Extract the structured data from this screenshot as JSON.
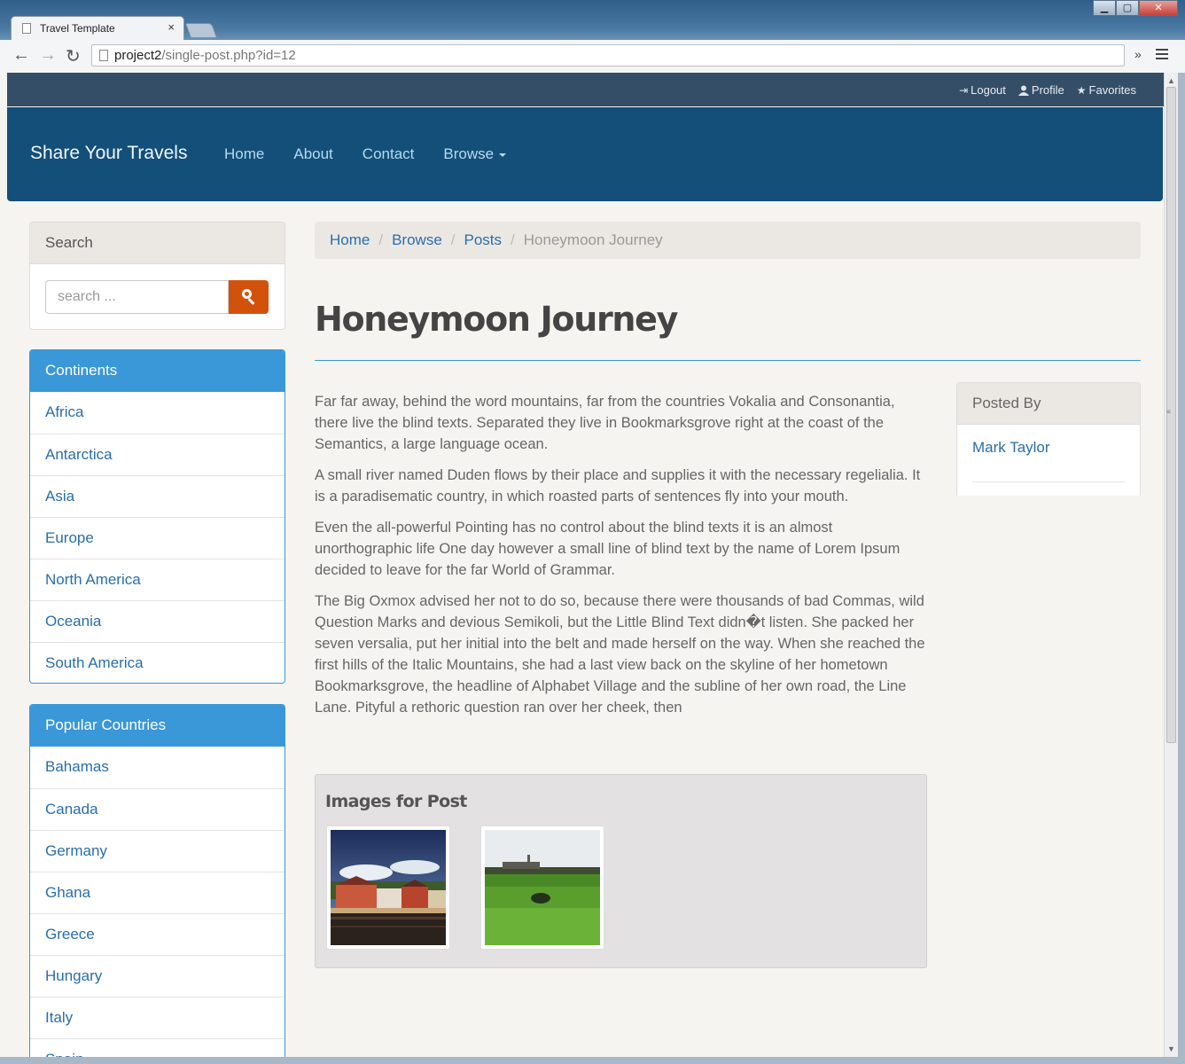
{
  "browser": {
    "tab_title": "Travel Template",
    "tab_close": "×",
    "url_host": "project2",
    "url_path": "/single-post.php?id=12",
    "extensions_glyph": "»"
  },
  "userbar": {
    "logout": "Logout",
    "profile": "Profile",
    "favorites": "Favorites"
  },
  "navbar": {
    "brand": "Share Your Travels",
    "links": [
      "Home",
      "About",
      "Contact",
      "Browse"
    ]
  },
  "search": {
    "heading": "Search",
    "placeholder": "search ..."
  },
  "continents": {
    "heading": "Continents",
    "items": [
      "Africa",
      "Antarctica",
      "Asia",
      "Europe",
      "North America",
      "Oceania",
      "South America"
    ]
  },
  "countries": {
    "heading": "Popular Countries",
    "items": [
      "Bahamas",
      "Canada",
      "Germany",
      "Ghana",
      "Greece",
      "Hungary",
      "Italy",
      "Spain"
    ]
  },
  "breadcrumb": {
    "items": [
      "Home",
      "Browse",
      "Posts"
    ],
    "active": "Honeymoon Journey",
    "separator": "/"
  },
  "post": {
    "title": "Honeymoon Journey",
    "paragraphs": [
      "Far far away, behind the word mountains, far from the countries Vokalia and Consonantia, there live the blind texts. Separated they live in Bookmarksgrove right at the coast of the Semantics, a large language ocean.",
      "A small river named Duden flows by their place and supplies it with the necessary regelialia. It is a paradisematic country, in which roasted parts of sentences fly into your mouth.",
      "Even the all-powerful Pointing has no control about the blind texts it is an almost unorthographic life One day however a small line of blind text by the name of Lorem Ipsum decided to leave for the far World of Grammar.",
      "The Big Oxmox advised her not to do so, because there were thousands of bad Commas, wild Question Marks and devious Semikoli, but the Little Blind Text didn�t listen. She packed her seven versalia, put her initial into the belt and made herself on the way. When she reached the first hills of the Italic Mountains, she had a last view back on the skyline of her hometown Bookmarksgrove, the headline of Alphabet Village and the subline of her own road, the Line Lane. Pityful a rethoric question ran over her cheek, then"
    ],
    "images_heading": "Images for Post"
  },
  "posted_by": {
    "heading": "Posted By",
    "author": "Mark Taylor"
  },
  "colors": {
    "navbar": "#134f79",
    "userbar": "#344e67",
    "accent": "#3a97d8",
    "search_button": "#d2520c",
    "link": "#2a6eab"
  }
}
